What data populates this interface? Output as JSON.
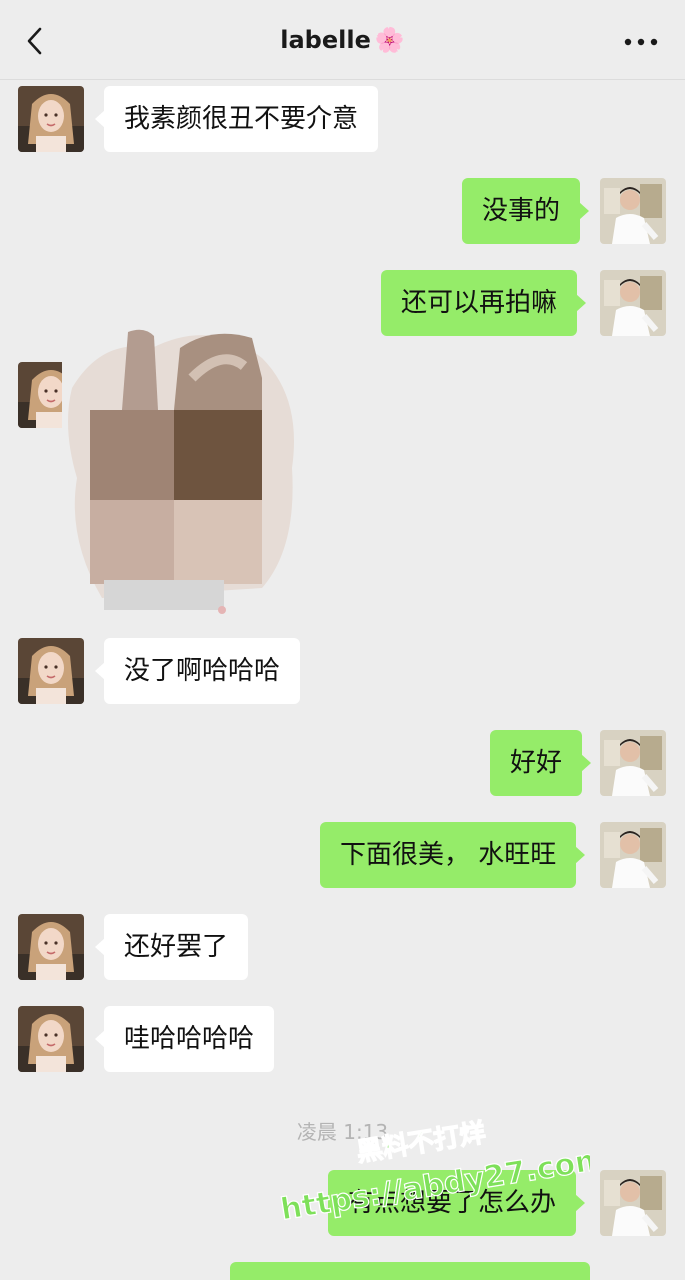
{
  "header": {
    "title": "labelle",
    "title_emoji": "🌸",
    "back_icon": "chevron-left-icon",
    "more_icon": "more-dots-icon"
  },
  "messages": [
    {
      "side": "in",
      "text": "我素颜很丑不要介意"
    },
    {
      "side": "out",
      "text": "没事的"
    },
    {
      "side": "out",
      "text": "还可以再拍嘛"
    },
    {
      "side": "in",
      "type": "image",
      "icon": "pixelated-photo"
    },
    {
      "side": "in",
      "text": "没了啊哈哈哈"
    },
    {
      "side": "out",
      "text": "好好"
    },
    {
      "side": "out",
      "text": "下面很美， 水旺旺"
    },
    {
      "side": "in",
      "text": "还好罢了"
    },
    {
      "side": "in",
      "text": "哇哈哈哈哈"
    },
    {
      "side": "out",
      "text": "有点想要了怎么办"
    }
  ],
  "timestamp": "凌晨 1:13",
  "watermark": {
    "line1": "黑料不打烊",
    "line2": "https://abdy27.com"
  },
  "colors": {
    "background": "#ededed",
    "outgoing_bubble": "#95ec69",
    "incoming_bubble": "#ffffff",
    "watermark": "#7ee05a"
  }
}
